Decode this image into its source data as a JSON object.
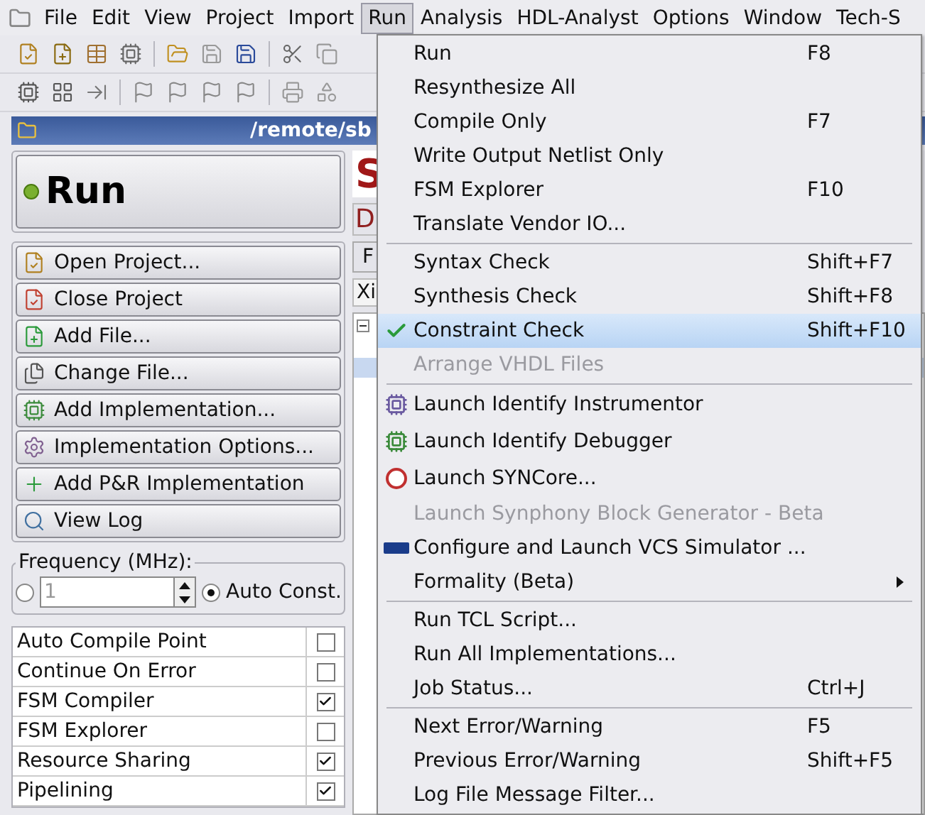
{
  "menubar": {
    "items": [
      {
        "label": "File",
        "selected": false
      },
      {
        "label": "Edit",
        "selected": false
      },
      {
        "label": "View",
        "selected": false
      },
      {
        "label": "Project",
        "selected": false
      },
      {
        "label": "Import",
        "selected": false
      },
      {
        "label": "Run",
        "selected": true
      },
      {
        "label": "Analysis",
        "selected": false
      },
      {
        "label": "HDL-Analyst",
        "selected": false
      },
      {
        "label": "Options",
        "selected": false
      },
      {
        "label": "Window",
        "selected": false
      },
      {
        "label": "Tech-S",
        "selected": false
      }
    ]
  },
  "window": {
    "title": "/remote/sb"
  },
  "run_button": {
    "label": "Run"
  },
  "actions": [
    "Open Project...",
    "Close Project",
    "Add File...",
    "Change File...",
    "Add Implementation...",
    "Implementation Options...",
    "Add P&R Implementation",
    "View Log"
  ],
  "frequency": {
    "legend": "Frequency (MHz):",
    "modes": [
      {
        "kind": "field",
        "value": "1",
        "selected": false
      },
      {
        "kind": "auto",
        "label": "Auto Const.",
        "selected": true
      }
    ]
  },
  "options": [
    {
      "label": "Auto Compile Point",
      "checked": false
    },
    {
      "label": "Continue On Error",
      "checked": false
    },
    {
      "label": "FSM Compiler",
      "checked": true
    },
    {
      "label": "FSM Explorer",
      "checked": false
    },
    {
      "label": "Resource Sharing",
      "checked": true
    },
    {
      "label": "Pipelining",
      "checked": true
    }
  ],
  "project_panel": {
    "logo_letter": "S",
    "title_letter": "D",
    "tab": "F",
    "header": "Xi"
  },
  "run_menu": {
    "items": [
      {
        "kind": "plain",
        "label": "Run",
        "shortcut": "F8",
        "disabled": false,
        "selected": false
      },
      {
        "kind": "plain",
        "label": "Resynthesize All",
        "disabled": false,
        "selected": false
      },
      {
        "kind": "plain",
        "label": "Compile Only",
        "shortcut": "F7",
        "disabled": false,
        "selected": false
      },
      {
        "kind": "plain",
        "label": "Write Output Netlist Only",
        "disabled": false,
        "selected": false
      },
      {
        "kind": "plain",
        "label": "FSM Explorer",
        "shortcut": "F10",
        "disabled": false,
        "selected": false
      },
      {
        "kind": "plain",
        "label": "Translate Vendor IO...",
        "disabled": false,
        "selected": false
      },
      {
        "kind": "separator"
      },
      {
        "kind": "plain",
        "label": "Syntax Check",
        "shortcut": "Shift+F7",
        "disabled": false,
        "selected": false
      },
      {
        "kind": "plain",
        "label": "Synthesis Check",
        "shortcut": "Shift+F8",
        "disabled": false,
        "selected": false
      },
      {
        "kind": "check",
        "label": "Constraint Check",
        "shortcut": "Shift+F10",
        "disabled": false,
        "selected": true
      },
      {
        "kind": "plain",
        "label": "Arrange VHDL Files",
        "disabled": true,
        "selected": false
      },
      {
        "kind": "separator"
      },
      {
        "kind": "probe",
        "label": "Launch Identify Instrumentor",
        "disabled": false,
        "selected": false
      },
      {
        "kind": "debug",
        "label": "Launch Identify Debugger",
        "disabled": false,
        "selected": false
      },
      {
        "kind": "syncore",
        "label": "Launch SYNCore...",
        "disabled": false,
        "selected": false
      },
      {
        "kind": "plain",
        "label": "Launch Synphony Block Generator - Beta",
        "disabled": true,
        "selected": false
      },
      {
        "kind": "vcs",
        "label": "Configure and Launch VCS Simulator ...",
        "disabled": false,
        "selected": false
      },
      {
        "kind": "submenu",
        "label": "Formality (Beta)",
        "disabled": false,
        "selected": false
      },
      {
        "kind": "separator"
      },
      {
        "kind": "plain",
        "label": "Run TCL Script...",
        "disabled": false,
        "selected": false
      },
      {
        "kind": "plain",
        "label": "Run All Implementations...",
        "disabled": false,
        "selected": false
      },
      {
        "kind": "plain",
        "label": "Job Status...",
        "shortcut": "Ctrl+J",
        "disabled": false,
        "selected": false
      },
      {
        "kind": "separator"
      },
      {
        "kind": "plain",
        "label": "Next Error/Warning",
        "shortcut": "F5",
        "disabled": false,
        "selected": false
      },
      {
        "kind": "plain",
        "label": "Previous Error/Warning",
        "shortcut": "Shift+F5",
        "disabled": false,
        "selected": false
      },
      {
        "kind": "plain",
        "label": "Log File Message Filter...",
        "disabled": false,
        "selected": false
      }
    ]
  }
}
